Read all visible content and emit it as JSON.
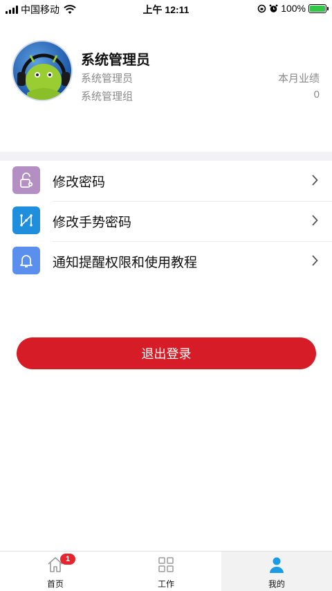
{
  "status_bar": {
    "carrier": "中国移动",
    "time": "上午 12:11",
    "battery": "100%"
  },
  "profile": {
    "name": "系统管理员",
    "role": "系统管理员",
    "group": "系统管理组",
    "performance_label": "本月业绩",
    "performance_value": "0"
  },
  "menu": {
    "items": [
      {
        "label": "修改密码",
        "icon": "lock-gear-icon",
        "color": "#b38fc4"
      },
      {
        "label": "修改手势密码",
        "icon": "gesture-pattern-icon",
        "color": "#1f8fdd"
      },
      {
        "label": "通知提醒权限和使用教程",
        "icon": "bell-icon",
        "color": "#5b8fee"
      }
    ]
  },
  "logout": {
    "label": "退出登录",
    "color": "#d61c26"
  },
  "tab_bar": {
    "tabs": [
      {
        "label": "首页",
        "icon": "home-icon",
        "badge": "1"
      },
      {
        "label": "工作",
        "icon": "grid-icon"
      },
      {
        "label": "我的",
        "icon": "user-icon",
        "active": true
      }
    ]
  }
}
